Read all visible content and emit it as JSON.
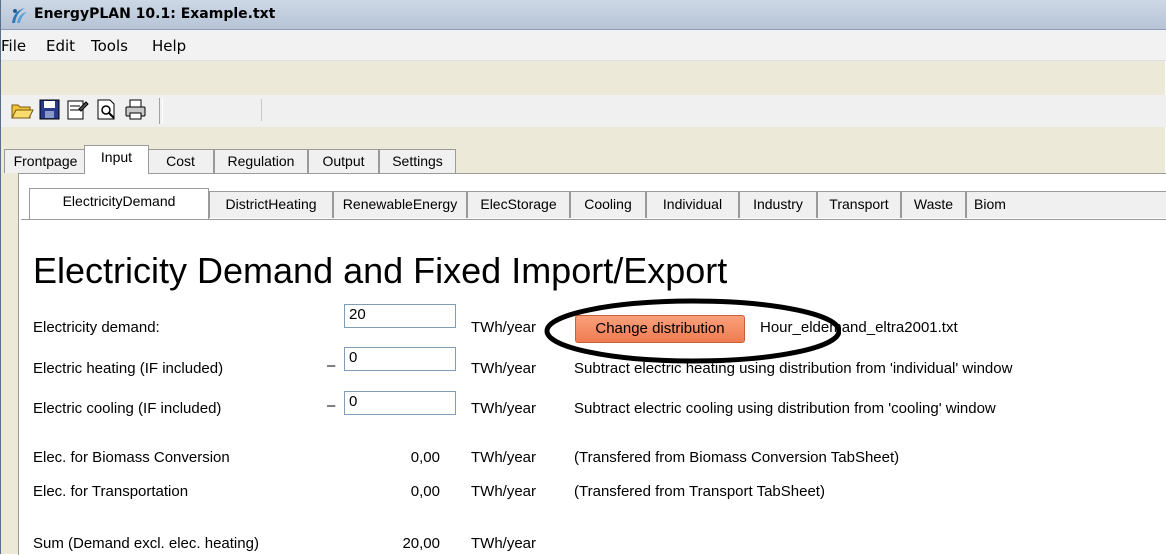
{
  "window": {
    "title": "EnergyPLAN 10.1: Example.txt"
  },
  "menu": [
    "File",
    "Edit",
    "Tools",
    "Help"
  ],
  "toolbar": {
    "buttons": [
      "open-icon",
      "save-icon",
      "properties-icon",
      "print-preview-icon",
      "print-icon"
    ]
  },
  "tabs_main": [
    "Frontpage",
    "Input",
    "Cost",
    "Regulation",
    "Output",
    "Settings"
  ],
  "tabs_main_active": "Input",
  "tabs_input": [
    "ElectricityDemand",
    "DistrictHeating",
    "RenewableEnergy",
    "ElecStorage",
    "Cooling",
    "Individual",
    "Industry",
    "Transport",
    "Waste",
    "Biom"
  ],
  "tabs_input_active": "ElectricityDemand",
  "heading": "Electricity Demand and Fixed Import/Export",
  "rows": {
    "demand": {
      "label": "Electricity demand:",
      "value": "20",
      "unit": "TWh/year",
      "button": "Change distribution",
      "file": "Hour_eldemand_eltra2001.txt"
    },
    "heating": {
      "label": "Electric heating (IF included)",
      "sign": "–",
      "value": "0",
      "unit": "TWh/year",
      "note": "Subtract electric heating using distribution from 'individual' window"
    },
    "cooling": {
      "label": "Electric cooling (IF included)",
      "sign": "–",
      "value": "0",
      "unit": "TWh/year",
      "note": "Subtract electric cooling using distribution from 'cooling' window"
    },
    "biomass": {
      "label": "Elec. for Biomass Conversion",
      "value": "0,00",
      "unit": "TWh/year",
      "note": "(Transfered from Biomass Conversion TabSheet)"
    },
    "transport": {
      "label": "Elec. for Transportation",
      "value": "0,00",
      "unit": "TWh/year",
      "note": "(Transfered from Transport TabSheet)"
    },
    "sum": {
      "label": "Sum (Demand excl. elec. heating)",
      "value": "20,00",
      "unit": "TWh/year"
    }
  },
  "colors": {
    "button_accent": "#f07c52",
    "highlight_ellipse": "#000000"
  }
}
